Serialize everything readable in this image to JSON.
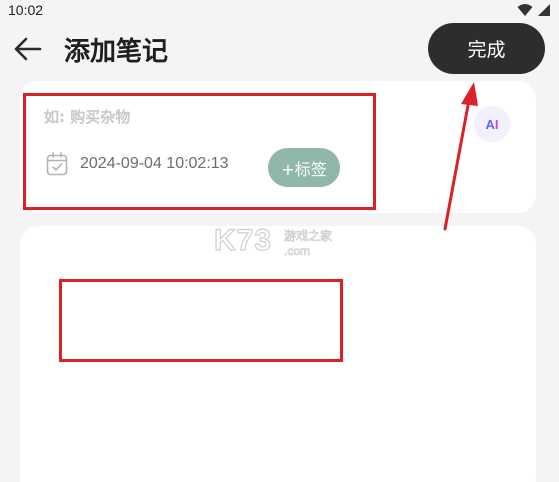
{
  "status_bar": {
    "time": "10:02"
  },
  "header": {
    "title": "添加笔记",
    "done_label": "完成"
  },
  "note_form": {
    "title_placeholder": "如: 购买杂物",
    "ai_label": "AI",
    "datetime": "2024-09-04 10:02:13",
    "tag_button_label": "+标签"
  },
  "watermark": {
    "brand": "K73",
    "cn": "游戏之家",
    "domain": ".com"
  },
  "colors": {
    "done_button": "#2d2d2f",
    "tag_button": "#8fb8a8",
    "highlight": "#dd1f26",
    "background": "#f4f4f6",
    "card": "#ffffff"
  },
  "icons": {
    "back": "arrow-left-icon",
    "calendar": "calendar-check-icon",
    "wifi": "wifi-icon",
    "signal": "cell-signal-icon"
  }
}
